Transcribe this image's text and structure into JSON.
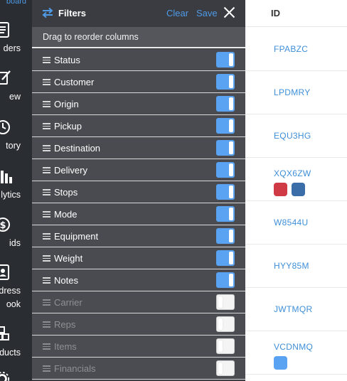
{
  "nav": {
    "top_label": "board",
    "items": [
      {
        "label": "ders",
        "icon": "document-icon"
      },
      {
        "label": "ew",
        "icon": "edit-icon"
      },
      {
        "label": "tory",
        "icon": "clock-icon"
      },
      {
        "label": "lytics",
        "icon": "analytics-icon"
      },
      {
        "label": "ids",
        "icon": "dollar-icon"
      },
      {
        "label": "dress",
        "label2": "ook",
        "icon": "address-book-icon"
      },
      {
        "label": "ducts",
        "icon": "products-icon"
      }
    ]
  },
  "panel": {
    "title": "Filters",
    "clear_label": "Clear",
    "save_label": "Save",
    "hint": "Drag to reorder columns",
    "columns": [
      {
        "label": "Status",
        "enabled": true
      },
      {
        "label": "Customer",
        "enabled": true
      },
      {
        "label": "Origin",
        "enabled": true
      },
      {
        "label": "Pickup",
        "enabled": true
      },
      {
        "label": "Destination",
        "enabled": true
      },
      {
        "label": "Delivery",
        "enabled": true
      },
      {
        "label": "Stops",
        "enabled": true
      },
      {
        "label": "Mode",
        "enabled": true
      },
      {
        "label": "Equipment",
        "enabled": true
      },
      {
        "label": "Weight",
        "enabled": true
      },
      {
        "label": "Notes",
        "enabled": true
      },
      {
        "label": "Carrier",
        "enabled": false
      },
      {
        "label": "Reps",
        "enabled": false
      },
      {
        "label": "Items",
        "enabled": false
      },
      {
        "label": "Financials",
        "enabled": false
      }
    ]
  },
  "table": {
    "header": "ID",
    "rows": [
      {
        "id": "FPABZC",
        "tags": []
      },
      {
        "id": "LPDMRY",
        "tags": []
      },
      {
        "id": "EQU3HG",
        "tags": []
      },
      {
        "id": "XQX6ZW",
        "tags": [
          "#d03a45",
          "#3b6ea8"
        ]
      },
      {
        "id": "W8544U",
        "tags": []
      },
      {
        "id": "HYY85M",
        "tags": []
      },
      {
        "id": "JWTMQR",
        "tags": []
      },
      {
        "id": "VCDNMQ",
        "tags": [
          "#5aa2f2"
        ]
      }
    ]
  },
  "colors": {
    "accent": "#4f9be8",
    "toggle_on": "#5aa2f2",
    "panel_bg": "#3d3f44"
  }
}
